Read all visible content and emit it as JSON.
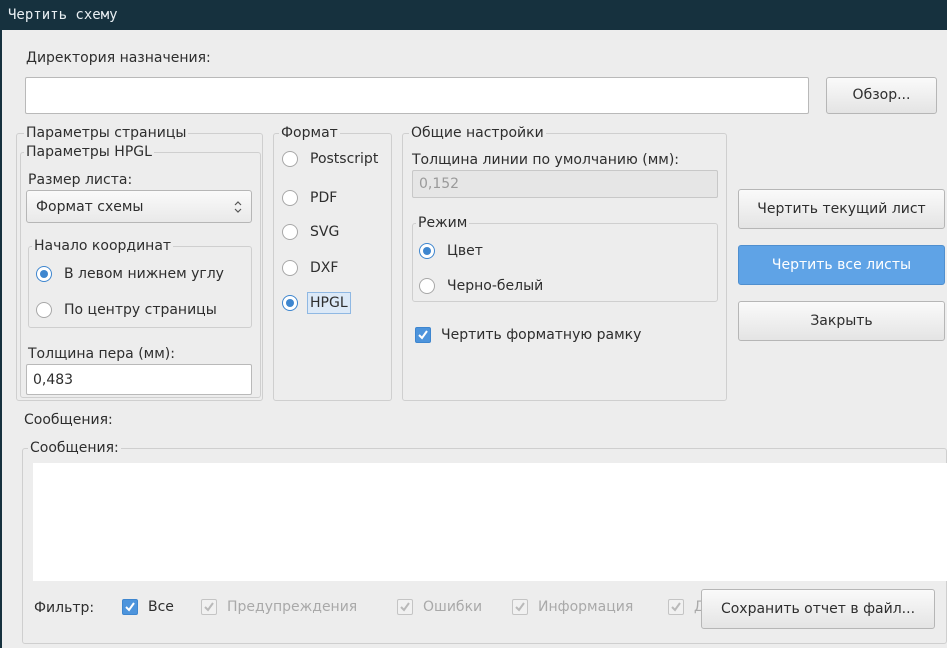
{
  "window": {
    "title": "Чертить схему"
  },
  "output_dir": {
    "label": "Директория назначения:",
    "value": "",
    "browse_button": "Обзор..."
  },
  "page_params": {
    "title": "Параметры страницы",
    "hpgl": {
      "title": "Параметры HPGL",
      "sheet_size_label": "Размер листа:",
      "sheet_size_value": "Формат схемы",
      "origin": {
        "title": "Начало координат",
        "options": [
          {
            "label": "В левом нижнем углу",
            "selected": true
          },
          {
            "label": "По центру страницы",
            "selected": false
          }
        ]
      },
      "pen_width_label": "Толщина пера (мм):",
      "pen_width_value": "0,483"
    }
  },
  "format": {
    "title": "Формат",
    "options": [
      {
        "label": "Postscript",
        "selected": false
      },
      {
        "label": "PDF",
        "selected": false
      },
      {
        "label": "SVG",
        "selected": false
      },
      {
        "label": "DXF",
        "selected": false
      },
      {
        "label": "HPGL",
        "selected": true
      }
    ]
  },
  "general": {
    "title": "Общие настройки",
    "line_width_label": "Толщина линии по умолчанию (мм):",
    "line_width_value": "0,152",
    "mode": {
      "title": "Режим",
      "options": [
        {
          "label": "Цвет",
          "selected": true
        },
        {
          "label": "Черно-белый",
          "selected": false
        }
      ]
    },
    "draw_frame": {
      "label": "Чертить форматную рамку",
      "checked": true
    }
  },
  "actions": {
    "plot_current": "Чертить текущий лист",
    "plot_all": "Чертить все листы",
    "close": "Закрыть"
  },
  "messages": {
    "label": "Сообщения:",
    "group_title": "Сообщения:",
    "filter_label": "Фильтр:",
    "filters": [
      {
        "label": "Все",
        "checked": true,
        "enabled": true
      },
      {
        "label": "Предупреждения",
        "checked": true,
        "enabled": false
      },
      {
        "label": "Ошибки",
        "checked": true,
        "enabled": false
      },
      {
        "label": "Информация",
        "checked": true,
        "enabled": false
      },
      {
        "label": "Д",
        "checked": true,
        "enabled": false
      }
    ],
    "save_button": "Сохранить отчет в файл..."
  },
  "colors": {
    "accent": "#3e86cf",
    "titlebar": "#16313e",
    "primary_button": "#5fa3e6"
  }
}
